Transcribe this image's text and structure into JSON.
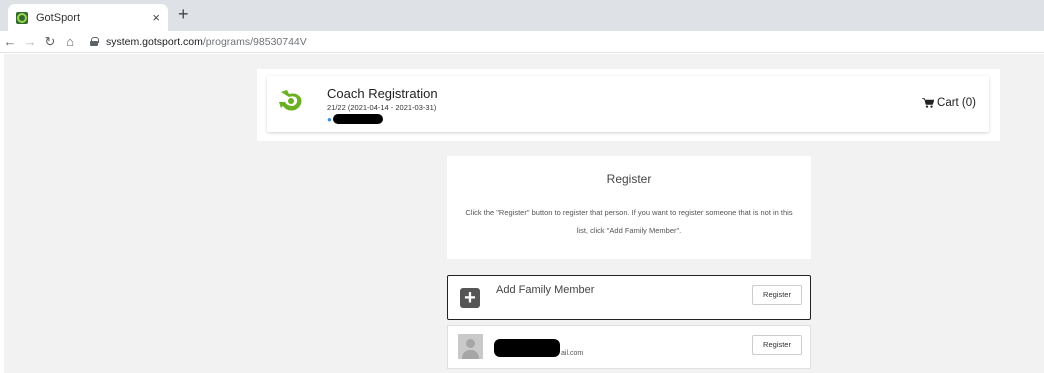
{
  "browser": {
    "tab_title": "GotSport",
    "tab_close": "×",
    "new_tab": "+",
    "url_host": "system.gotsport.com",
    "url_path": "/programs/98530744V"
  },
  "program": {
    "title": "Coach Registration",
    "dates": "21/22 (2021-04-14 - 2021-03-31)",
    "cart_label": "Cart (0)"
  },
  "register_panel": {
    "title": "Register",
    "instructions": "Click the \"Register\" button to register that person. If you want to register someone that is not in this list, click \"Add Family Member\"."
  },
  "rows": {
    "add_member": {
      "label": "Add Family Member",
      "button": "Register"
    },
    "person": {
      "email_suffix": "ail.com",
      "button": "Register"
    }
  },
  "colors": {
    "brand_green": "#6ab023",
    "page_bg": "#f2f2f2",
    "user_icon_blue": "#3b8fe0"
  }
}
